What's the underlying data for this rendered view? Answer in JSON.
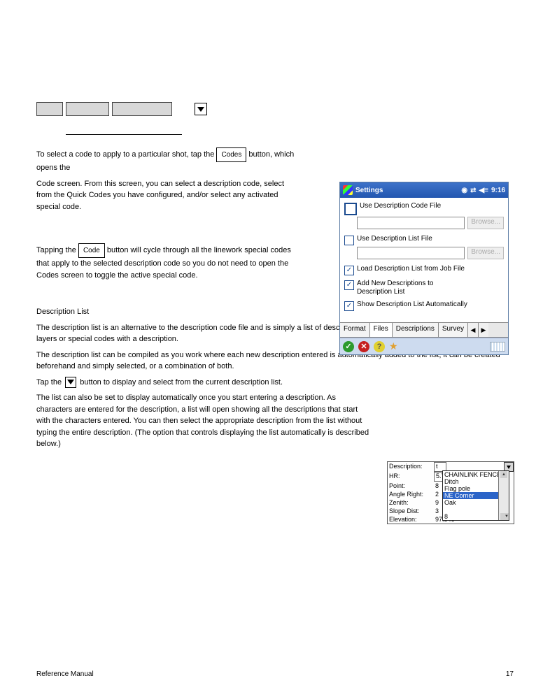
{
  "toolbar": {
    "btn1": "",
    "btn2": "",
    "btn3": ""
  },
  "section1": {
    "title_underline_only": true,
    "para1_pre": "To select a code to apply to a particular shot, tap the",
    "para1_btn": "Codes",
    "para1_post": "button, which opens the",
    "para2_a": "Code screen. From this screen, you can select a description code,",
    "para2_b": "select from the Quick Codes you have configured, and/or",
    "para2_c": "select any activated special code.",
    "para3_a": "Tapping the",
    "para3_btn": "Code",
    "para3_b": "button will cycle through all the",
    "para3_c": "linework special codes that apply to the selected",
    "para3_d": "description code so you do not need to open the Codes",
    "para3_e": "screen to toggle the active special code."
  },
  "pda": {
    "title": "Settings",
    "time": "9:16",
    "chk_code_file": "Use Description Code File",
    "browse": "Browse...",
    "chk_list_file": "Use Description List File",
    "chk_load": "Load Description List from Job File",
    "chk_addnew_a": "Add New Descriptions to",
    "chk_addnew_b": "Description List",
    "chk_show_auto": "Show Description List Automatically",
    "tabs": [
      "Format",
      "Files",
      "Descriptions",
      "Survey"
    ]
  },
  "body2": {
    "h": "Description List",
    "p1": "The description list is an alternative to the description code file and is simply a list of descriptions. The description list does not associate layers or special codes with a description.",
    "p2": "The description list can be compiled as you work where each new description entered is automatically added to the list, it can be created beforehand and simply selected, or a combination of both.",
    "p3_a": "Tap the",
    "p3_b": "button to display and select from the current description list.",
    "p4": "The list can also be set to display automatically once you start entering a description. As characters are entered for the description, a list will open showing all the descriptions that start with the characters entered. You can then select the appropriate description from the list without typing the entire description. (The option that controls displaying the list automatically is described below.)"
  },
  "mini": {
    "lbl_description": "Description:",
    "desc_value": "t",
    "lbl_hr": "HR:",
    "hr_value": "5.750 ift",
    "lbl_point": "Point:",
    "point_value": "8",
    "lbl_angle": "Angle Right:",
    "angle_value": "2",
    "lbl_zenith": "Zenith:",
    "zenith_value": "9",
    "lbl_slope": "Slope Dist:",
    "slope_value": "3",
    "lbl_elev": "Elevation:",
    "elev_value": "97.546",
    "list": [
      "CHAINLINK FENCE",
      "Ditch",
      "Flag pole",
      "NE Corner",
      "Oak"
    ],
    "list_after": "8"
  },
  "footer": {
    "left": "Reference Manual",
    "right": "17"
  }
}
